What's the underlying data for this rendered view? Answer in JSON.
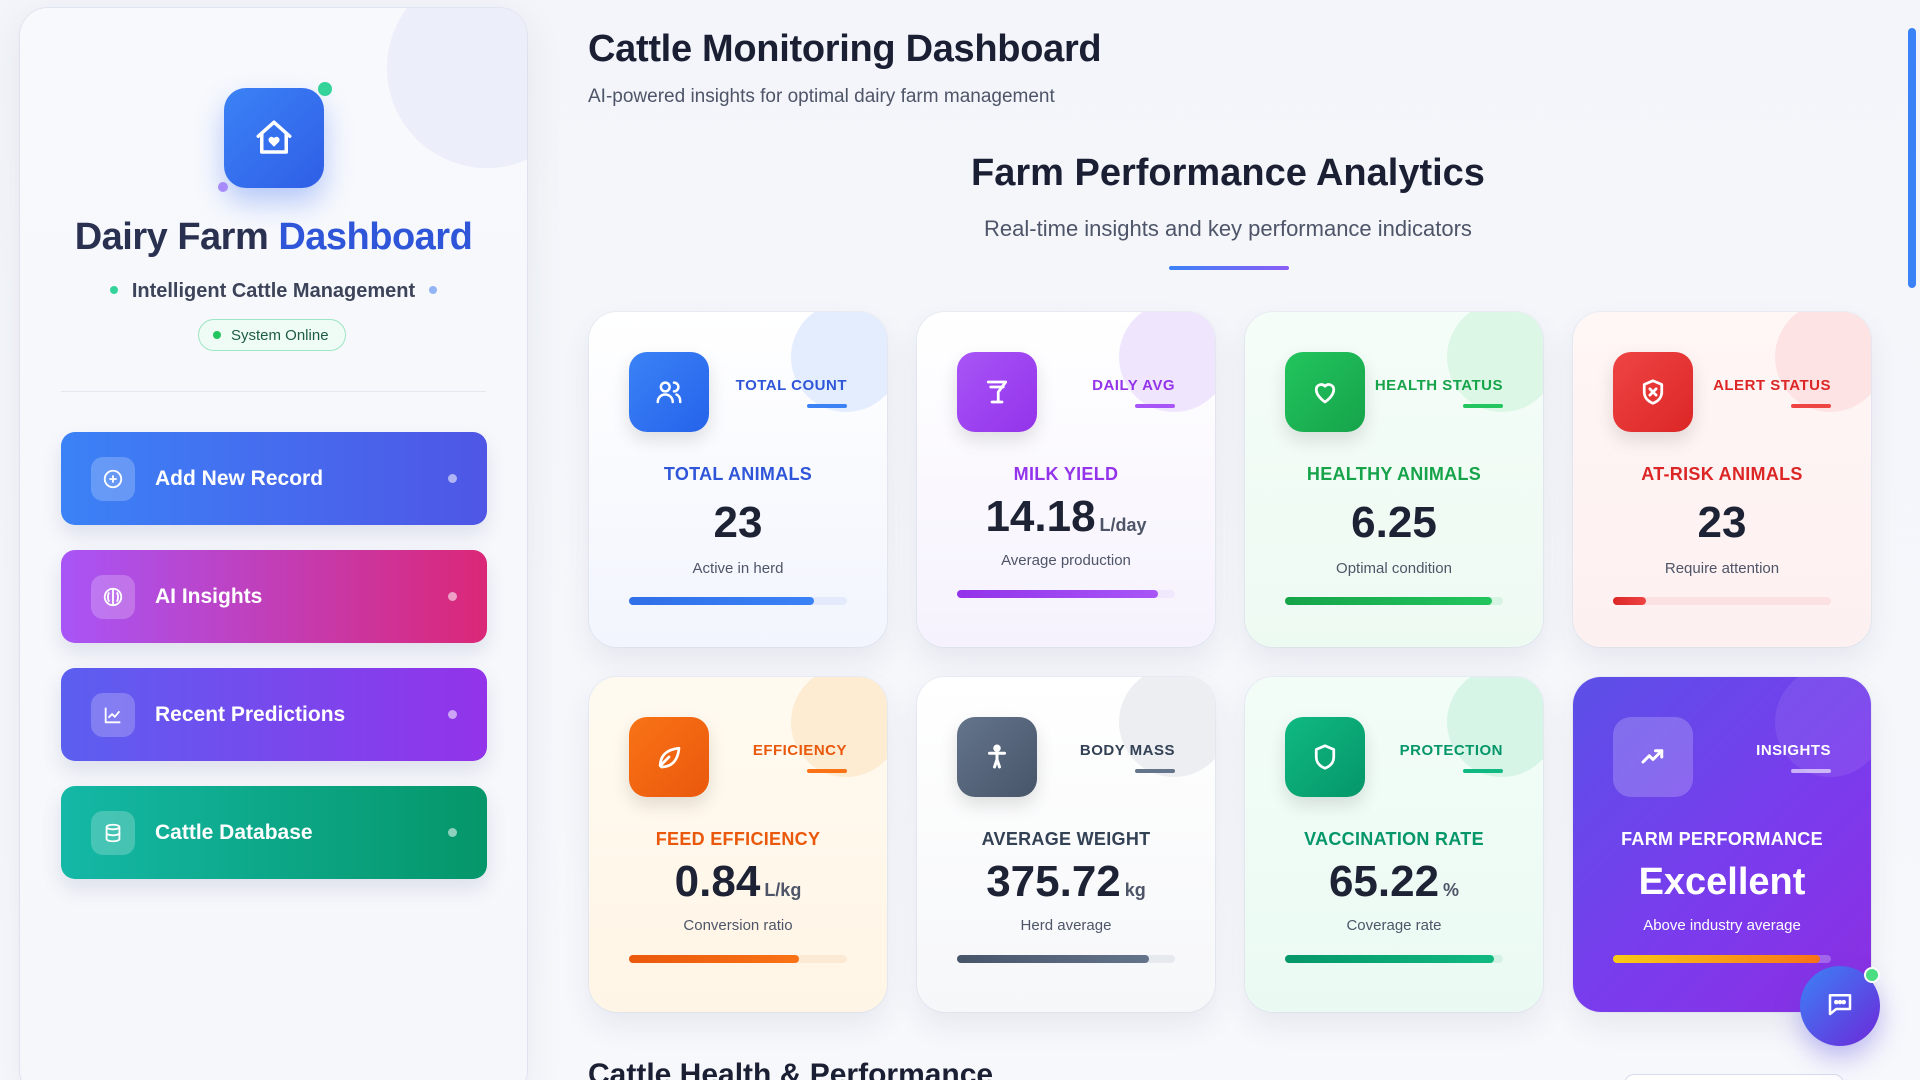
{
  "sidebar": {
    "brand_title_part1": "Dairy Farm",
    "brand_title_part2": "Dashboard",
    "subtitle": "Intelligent Cattle Management",
    "status": "System Online",
    "logo_icon": "home-heart-icon",
    "nav": [
      {
        "label": "Add New Record",
        "icon": "plus-circle-icon",
        "colors": [
          "#3b82f6",
          "#4f56e6"
        ]
      },
      {
        "label": "AI Insights",
        "icon": "brain-icon",
        "colors": [
          "#a855f7",
          "#db2777"
        ]
      },
      {
        "label": "Recent Predictions",
        "icon": "line-chart-icon",
        "colors": [
          "#5b5ff0",
          "#9333ea"
        ]
      },
      {
        "label": "Cattle Database",
        "icon": "database-icon",
        "colors": [
          "#14b8a6",
          "#059669"
        ]
      }
    ]
  },
  "header": {
    "title": "Cattle Monitoring Dashboard",
    "subtitle": "AI-powered insights for optimal dairy farm management"
  },
  "analytics": {
    "title": "Farm Performance Analytics",
    "subtitle": "Real-time insights and key performance indicators"
  },
  "cards": [
    {
      "tag": "TOTAL COUNT",
      "metric": "TOTAL ANIMALS",
      "value": "23",
      "unit": "",
      "desc": "Active in herd",
      "progress": 0.85,
      "accent": "#2f6fe8",
      "icon": "users-icon"
    },
    {
      "tag": "DAILY AVG",
      "metric": "MILK YIELD",
      "value": "14.18",
      "unit": "L/day",
      "desc": "Average production",
      "progress": 0.92,
      "accent": "#9333ea",
      "icon": "glass-icon"
    },
    {
      "tag": "HEALTH STATUS",
      "metric": "HEALTHY ANIMALS",
      "value": "6.25",
      "unit": "",
      "desc": "Optimal condition",
      "progress": 0.95,
      "accent": "#16a34a",
      "icon": "heart-icon"
    },
    {
      "tag": "ALERT STATUS",
      "metric": "AT-RISK ANIMALS",
      "value": "23",
      "unit": "",
      "desc": "Require attention",
      "progress": 0.15,
      "accent": "#dc2626",
      "icon": "shield-alert-icon"
    },
    {
      "tag": "EFFICIENCY",
      "metric": "FEED EFFICIENCY",
      "value": "0.84",
      "unit": "L/kg",
      "desc": "Conversion ratio",
      "progress": 0.78,
      "accent": "#ea580c",
      "icon": "leaf-icon"
    },
    {
      "tag": "BODY MASS",
      "metric": "AVERAGE WEIGHT",
      "value": "375.72",
      "unit": "kg",
      "desc": "Herd average",
      "progress": 0.88,
      "accent": "#475569",
      "icon": "person-icon"
    },
    {
      "tag": "PROTECTION",
      "metric": "VACCINATION RATE",
      "value": "65.22",
      "unit": "%",
      "desc": "Coverage rate",
      "progress": 0.96,
      "accent": "#059669",
      "icon": "shield-icon"
    },
    {
      "tag": "INSIGHTS",
      "metric": "FARM PERFORMANCE",
      "value": "Excellent",
      "unit": "",
      "desc": "Above industry average",
      "progress": 0.95,
      "accent": "#ffffff",
      "icon": "trend-up-icon"
    }
  ],
  "bottom_section_title": "Cattle Health & Performance",
  "chat_button_icon": "chat-icon"
}
